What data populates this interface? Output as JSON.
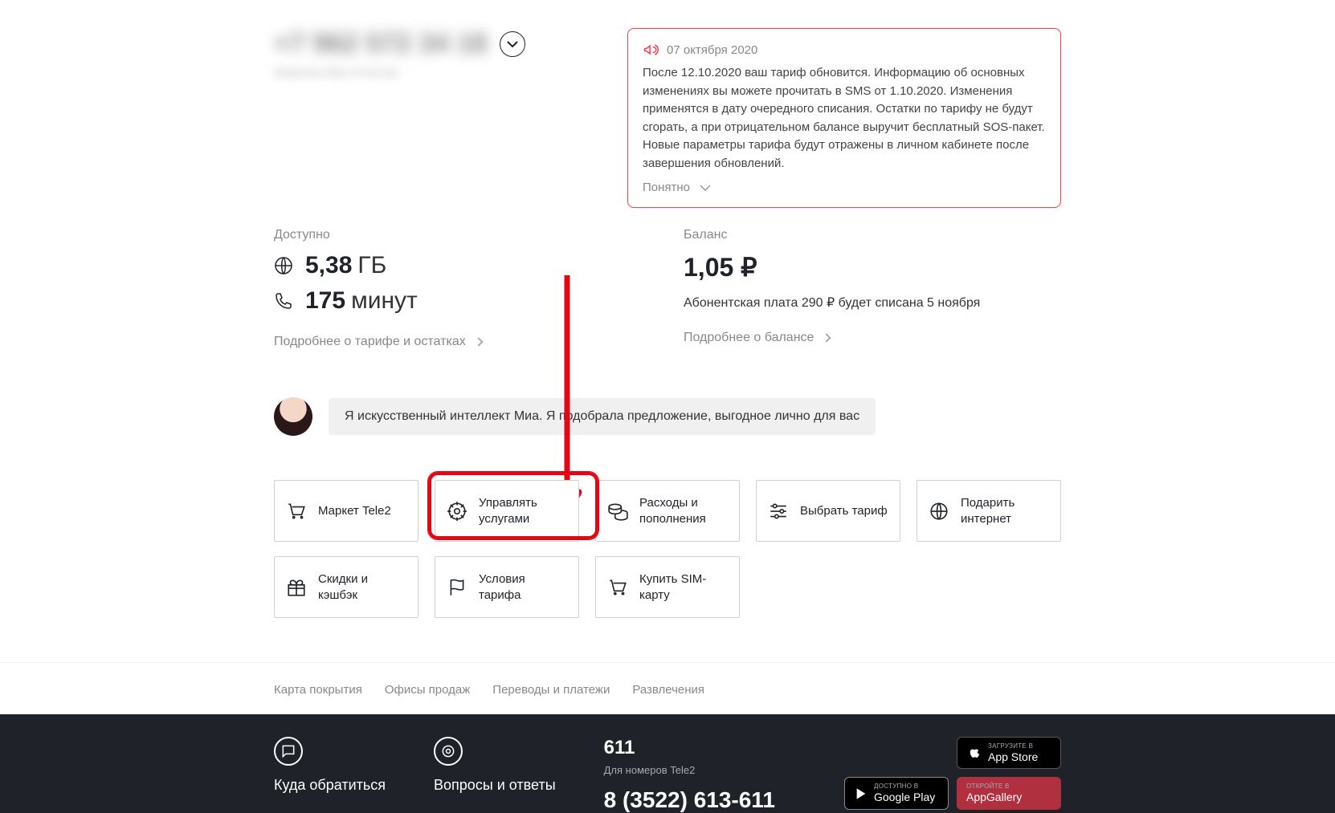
{
  "header": {
    "phone": "+7 962 572 34 18",
    "owner": "Фамилия Имя Отчество"
  },
  "notice": {
    "date": "07 октября 2020",
    "body": "После 12.10.2020 ваш тариф обновится. Информацию об основных изменениях вы можете прочитать в SMS от 1.10.2020. Изменения применятся в дату очередного списания. Остатки по тарифу не будут сгорать, а при отрицательном балансе выручит бесплатный SOS-пакет. Новые параметры тарифа будут отражены в личном кабинете после завершения обновлений.",
    "dismiss": "Понятно"
  },
  "available": {
    "label": "Доступно",
    "data_value": "5,38",
    "data_unit": "ГБ",
    "minutes_value": "175",
    "minutes_unit": "минут",
    "more": "Подробнее о тарифе и остатках"
  },
  "balance": {
    "label": "Баланс",
    "value": "1,05 ₽",
    "note": "Абонентская плата 290 ₽ будет списана 5 ноября",
    "more": "Подробнее о балансе"
  },
  "mia": {
    "text": "Я искусственный интеллект Миа. Я подобрала предложение, выгодное лично для вас"
  },
  "actions": {
    "market": "Маркет Tele2",
    "manage": "Управлять услугами",
    "expenses": "Расходы и пополнения",
    "choose_tariff": "Выбрать тариф",
    "gift_internet": "Подарить интернет",
    "cashback": "Скидки и кэшбэк",
    "tariff_terms": "Условия тарифа",
    "buy_sim": "Купить SIM-карту"
  },
  "footer_links": {
    "coverage": "Карта покрытия",
    "offices": "Офисы продаж",
    "payments": "Переводы и платежи",
    "entertainment": "Развлечения"
  },
  "dark_footer": {
    "contact_title": "Куда обратиться",
    "faq_title": "Вопросы и ответы",
    "short_number": "611",
    "short_label": "Для номеров Tele2",
    "phone": "8 (3522) 613-611",
    "appstore_small": "Загрузите в",
    "appstore_big": "App Store",
    "gplay_small": "Доступно в",
    "gplay_big": "Google Play",
    "appgallery_small": "Откройте в",
    "appgallery_big": "AppGallery"
  }
}
